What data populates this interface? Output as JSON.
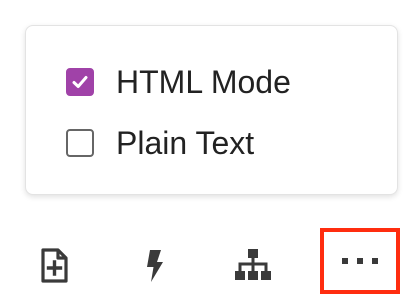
{
  "menu": {
    "options": [
      {
        "label": "HTML Mode",
        "checked": true
      },
      {
        "label": "Plain Text",
        "checked": false
      }
    ]
  },
  "toolbar": {
    "buttons": [
      {
        "icon": "new-document-icon"
      },
      {
        "icon": "lightning-icon"
      },
      {
        "icon": "hierarchy-icon"
      },
      {
        "icon": "more-horizontal-icon",
        "highlighted": true
      }
    ]
  },
  "colors": {
    "checkbox_accent": "#a042a8",
    "highlight_border": "#ff2d0f",
    "icon": "#3a3a3a"
  }
}
